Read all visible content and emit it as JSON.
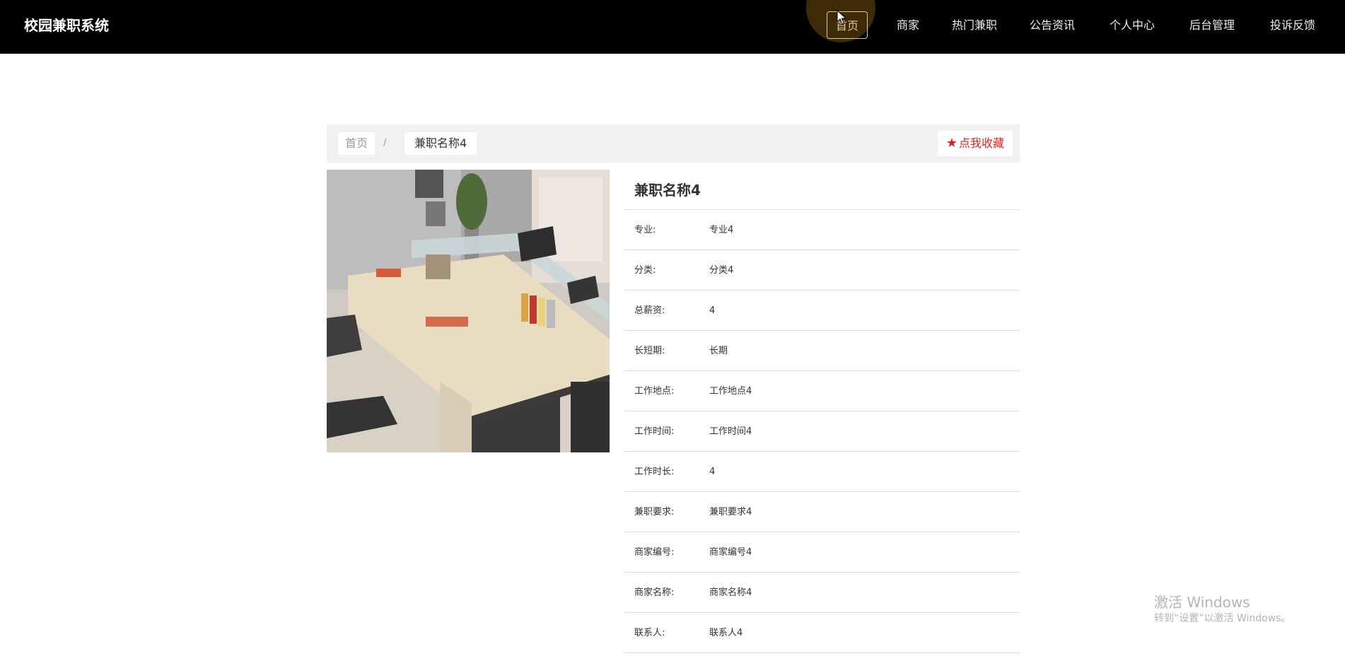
{
  "header": {
    "brand": "校园兼职系统",
    "nav": [
      {
        "label": "首页",
        "active": true
      },
      {
        "label": "商家",
        "active": false
      },
      {
        "label": "热门兼职",
        "active": false
      },
      {
        "label": "公告资讯",
        "active": false
      },
      {
        "label": "个人中心",
        "active": false
      },
      {
        "label": "后台管理",
        "active": false
      },
      {
        "label": "投诉反馈",
        "active": false
      }
    ]
  },
  "breadcrumb": {
    "home": "首页",
    "separator": "/",
    "current": "兼职名称4"
  },
  "favorite": {
    "icon": "star-icon",
    "label": "点我收藏"
  },
  "image": {
    "alt": "office desk photo"
  },
  "detail": {
    "title": "兼职名称4",
    "fields": [
      {
        "label": "专业:",
        "value": "专业4"
      },
      {
        "label": "分类:",
        "value": "分类4"
      },
      {
        "label": "总薪资:",
        "value": "4"
      },
      {
        "label": "长短期:",
        "value": "长期"
      },
      {
        "label": "工作地点:",
        "value": "工作地点4"
      },
      {
        "label": "工作时间:",
        "value": "工作时间4"
      },
      {
        "label": "工作时长:",
        "value": "4"
      },
      {
        "label": "兼职要求:",
        "value": "兼职要求4"
      },
      {
        "label": "商家编号:",
        "value": "商家编号4"
      },
      {
        "label": "商家名称:",
        "value": "商家名称4"
      },
      {
        "label": "联系人:",
        "value": "联系人4"
      }
    ]
  },
  "watermark": {
    "title": "激活 Windows",
    "subtitle": "转到“设置”以激活 Windows。"
  },
  "colors": {
    "nav_background": "#000000",
    "nav_active": "#e0c89a",
    "favorite_red": "#e02020",
    "breadcrumb_background": "#f1f1f1"
  }
}
